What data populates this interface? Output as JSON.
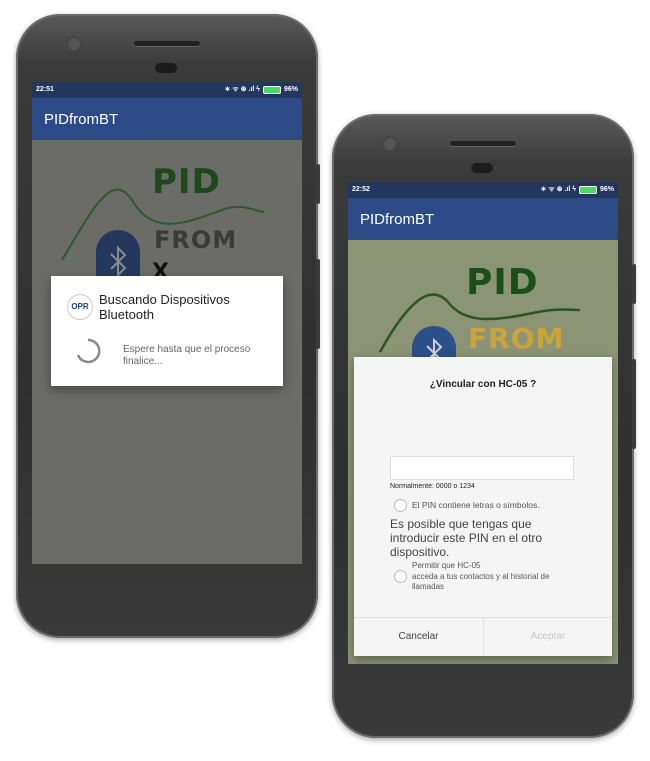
{
  "left_phone": {
    "status_time": "22:51",
    "status_icons": "∗ ᯤ ⊛ .ıl ϟ",
    "battery_label": "96%",
    "app_title": "PIDfromBT",
    "background_logo": {
      "pid_text": "PID",
      "from_text": "FROM",
      "bt_partial_text": "X"
    },
    "dialog": {
      "icon_label": "OPR",
      "title": "Buscando Dispositivos Bluetooth",
      "message": "Espere hasta que el proceso finalice..."
    }
  },
  "right_phone": {
    "status_time": "22:52",
    "status_icons": "∗ ᯤ ⊛ .ıl ϟ",
    "battery_label": "96%",
    "app_title": "PIDfromBT",
    "background_logo": {
      "pid_text": "PID",
      "from_text": "FROM"
    },
    "dialog": {
      "title": "¿Vincular con HC-05 ?",
      "pin_input_value": "",
      "pin_hint": "Normalmente: 0000 o 1234",
      "option_letters": "El PIN contiene letras o símbolos.",
      "info_text": "Es posible que tengas que introducir este PIN en el otro dispositivo.",
      "option_access_line1": "Permitir que HC-05",
      "option_access_line2": "acceda a tus contactos y al historial de llamadas",
      "cancel_label": "Cancelar",
      "accept_label": "Aceptar"
    }
  },
  "colors": {
    "status_bar": "#21375e",
    "app_bar": "#2c4b86",
    "logo_green": "#2d7d2a",
    "logo_gold": "#c8a235",
    "bluetooth_blue": "#2b4f8a",
    "battery_green": "#4cd964"
  },
  "icons": [
    "bluetooth-icon",
    "wifi-icon",
    "signal-icon",
    "charging-icon",
    "battery-icon",
    "spinner-icon",
    "opr-logo-icon"
  ]
}
